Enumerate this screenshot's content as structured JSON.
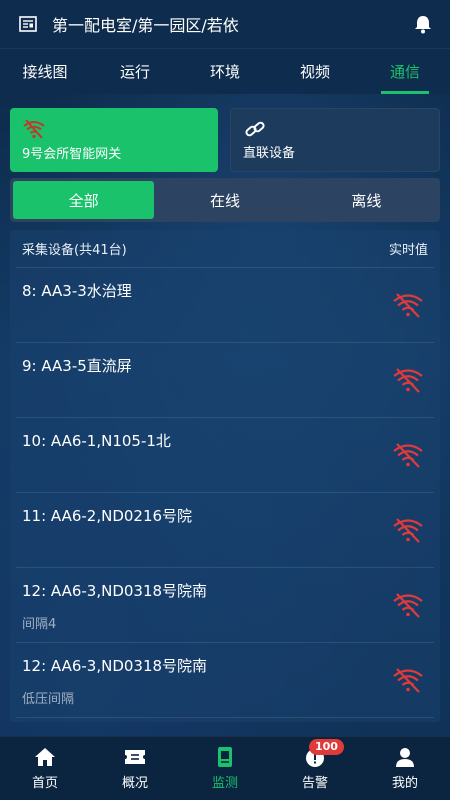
{
  "header": {
    "title": "第一配电室/第一园区/若依",
    "doc_icon": "document-list-icon",
    "bell_icon": "bell-icon"
  },
  "tabs": [
    {
      "label": "接线图",
      "active": false
    },
    {
      "label": "运行",
      "active": false
    },
    {
      "label": "环境",
      "active": false
    },
    {
      "label": "视频",
      "active": false
    },
    {
      "label": "通信",
      "active": true
    }
  ],
  "gateways": [
    {
      "label": "9号会所智能网关",
      "icon": "wifi-off-icon",
      "selected": true
    },
    {
      "label": "直联设备",
      "icon": "link-icon",
      "selected": false
    }
  ],
  "filter": {
    "options": [
      "全部",
      "在线",
      "离线"
    ],
    "selected": "全部"
  },
  "device_list": {
    "header_left": "采集设备(共41台)",
    "header_right": "实时值",
    "rows": [
      {
        "name": "8: AA3-3水治理",
        "sub": "",
        "status_icon": "wifi-off-icon"
      },
      {
        "name": "9: AA3-5直流屏",
        "sub": "",
        "status_icon": "wifi-off-icon"
      },
      {
        "name": "10: AA6-1,N105-1北",
        "sub": "",
        "status_icon": "wifi-off-icon"
      },
      {
        "name": "11: AA6-2,ND0216号院",
        "sub": "",
        "status_icon": "wifi-off-icon"
      },
      {
        "name": "12: AA6-3,ND0318号院南",
        "sub": "间隔4",
        "status_icon": "wifi-off-icon"
      },
      {
        "name": "12: AA6-3,ND0318号院南",
        "sub": "低压间隔",
        "status_icon": "wifi-off-icon"
      }
    ]
  },
  "bottom_nav": [
    {
      "label": "首页",
      "icon": "home-icon",
      "active": false
    },
    {
      "label": "概况",
      "icon": "ticket-icon",
      "active": false
    },
    {
      "label": "监测",
      "icon": "monitor-icon",
      "active": true
    },
    {
      "label": "告警",
      "icon": "alert-icon",
      "active": false,
      "badge": "100"
    },
    {
      "label": "我的",
      "icon": "user-icon",
      "active": false
    }
  ],
  "colors": {
    "accent": "#19c26b",
    "offline": "#e23a3a",
    "background": "#0d2745"
  }
}
